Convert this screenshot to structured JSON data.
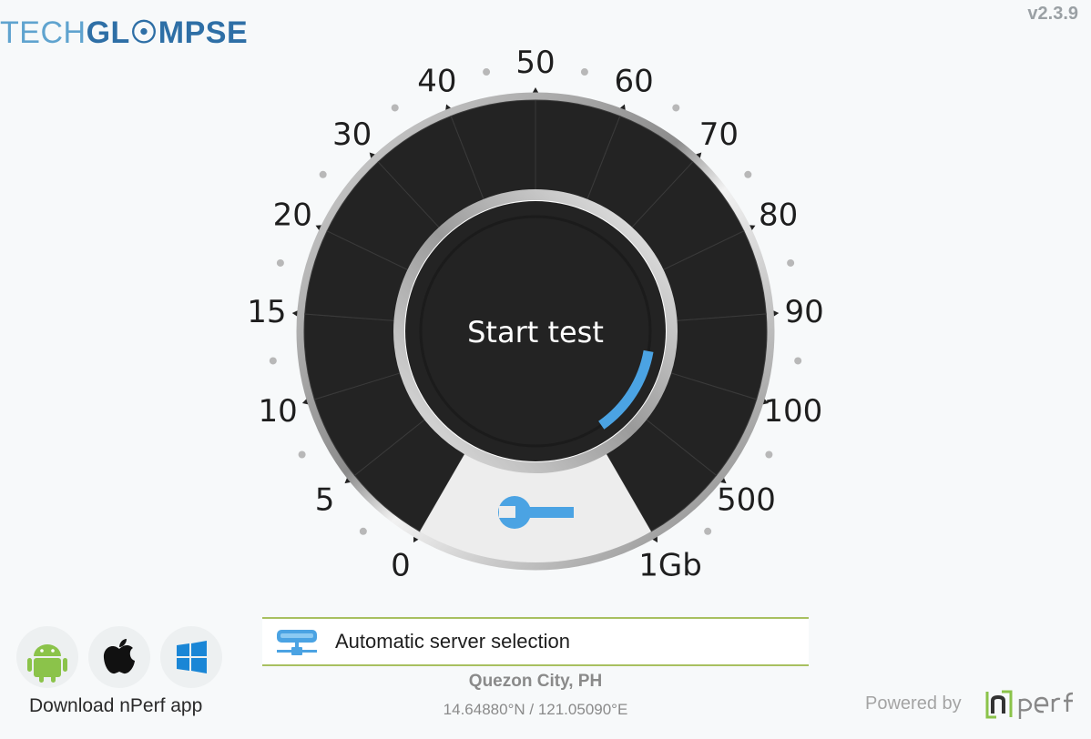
{
  "header": {
    "logo_part1": "TECH",
    "logo_part2": "GL",
    "logo_part3": "MPSE",
    "version": "v2.3.9"
  },
  "gauge": {
    "scale_labels": [
      "0",
      "5",
      "10",
      "15",
      "20",
      "30",
      "40",
      "50",
      "60",
      "70",
      "80",
      "90",
      "100",
      "500",
      "1Gb"
    ],
    "start_label": "Start test",
    "settings_icon": "wrench-icon",
    "accent_color": "#4ba3e3",
    "dial_color": "#232323"
  },
  "apps": {
    "items": [
      {
        "name": "android",
        "icon": "android-icon",
        "color": "#8bc34a"
      },
      {
        "name": "apple",
        "icon": "apple-icon",
        "color": "#111111"
      },
      {
        "name": "windows",
        "icon": "windows-icon",
        "color": "#1a86d6"
      }
    ],
    "download_label": "Download nPerf app"
  },
  "server": {
    "icon": "server-icon",
    "label": "Automatic server selection",
    "location": "Quezon City, PH",
    "coordinates": "14.64880°N / 121.05090°E"
  },
  "footer": {
    "powered_by": "Powered by",
    "brand_logo": "nperf"
  }
}
